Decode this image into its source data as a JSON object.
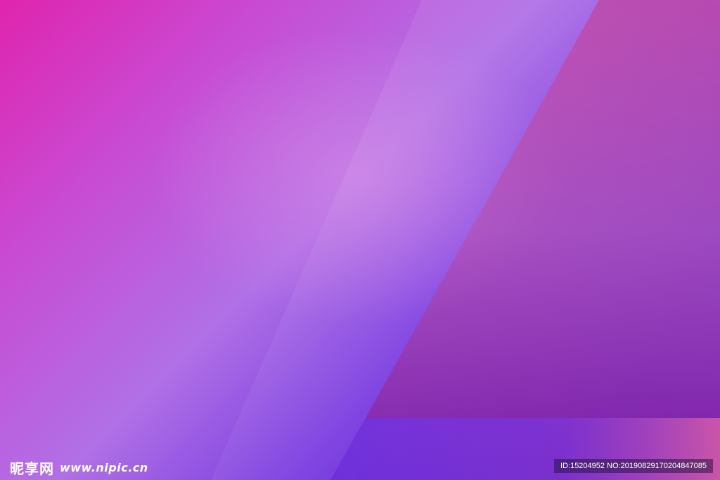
{
  "background": {
    "colors": {
      "magenta": "#e024ae",
      "orchid": "#c94ad3",
      "lavender": "#b070e6",
      "violet": "#7a3de0",
      "indigo": "#4a18d0",
      "panel_pink": "#c458b0",
      "panel_purple": "#8a2aa8"
    }
  },
  "watermark": {
    "logo_text": "昵享网",
    "site_url": "www.nipic.cn",
    "id_text": "ID:15204952 NO:20190829170204847085"
  }
}
